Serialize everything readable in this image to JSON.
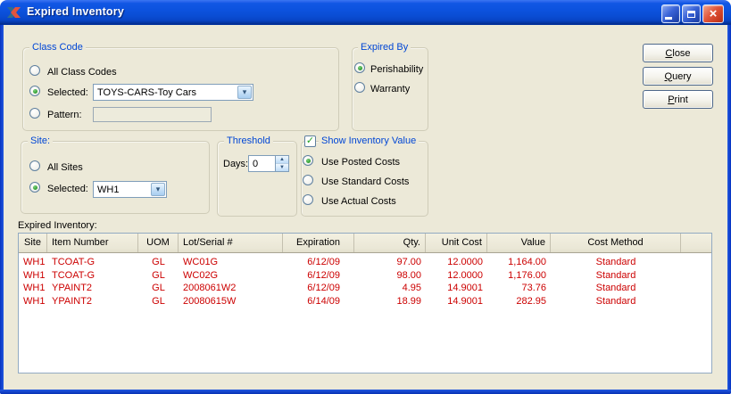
{
  "window": {
    "title": "Expired Inventory"
  },
  "icons": {
    "close": "×",
    "check": "✓",
    "chevron_down": "▾",
    "spin_up": "▲",
    "spin_down": "▼"
  },
  "colors": {
    "titlebar_blue": "#0C52DE",
    "group_title_blue": "#0046D5",
    "data_red": "#CC0000",
    "dialog_beige": "#ECE9D8"
  },
  "actions": [
    {
      "label": "Close"
    },
    {
      "label": "Query"
    },
    {
      "label": "Print"
    }
  ],
  "class_code": {
    "title": "Class Code",
    "all_label": "All Class Codes",
    "selected_label": "Selected:",
    "pattern_label": "Pattern:",
    "selected_option": "Selected",
    "combo_value": "TOYS-CARS-Toy Cars",
    "pattern_value": ""
  },
  "expired_by": {
    "title": "Expired By",
    "perishability_label": "Perishability",
    "warranty_label": "Warranty",
    "selected_option": "Perishability"
  },
  "site": {
    "title": "Site:",
    "all_label": "All Sites",
    "selected_label": "Selected:",
    "selected_option": "Selected",
    "combo_value": "WH1"
  },
  "threshold": {
    "title": "Threshold",
    "days_label": "Days:",
    "days_value": "0"
  },
  "inventory_value": {
    "title": "Show Inventory Value",
    "checked": true,
    "options": [
      "Use Posted Costs",
      "Use Standard Costs",
      "Use Actual Costs"
    ],
    "selected_option": "Use Posted Costs"
  },
  "table": {
    "label": "Expired Inventory:",
    "columns": [
      "Site",
      "Item Number",
      "UOM",
      "Lot/Serial #",
      "Expiration",
      "Qty.",
      "Unit Cost",
      "Value",
      "Cost Method"
    ],
    "rows": [
      [
        "WH1",
        "TCOAT-G",
        "GL",
        "WC01G",
        "6/12/09",
        "97.00",
        "12.0000",
        "1,164.00",
        "Standard"
      ],
      [
        "WH1",
        "TCOAT-G",
        "GL",
        "WC02G",
        "6/12/09",
        "98.00",
        "12.0000",
        "1,176.00",
        "Standard"
      ],
      [
        "WH1",
        "YPAINT2",
        "GL",
        "2008061W2",
        "6/12/09",
        "4.95",
        "14.9001",
        "73.76",
        "Standard"
      ],
      [
        "WH1",
        "YPAINT2",
        "GL",
        "20080615W",
        "6/14/09",
        "18.99",
        "14.9001",
        "282.95",
        "Standard"
      ]
    ]
  }
}
